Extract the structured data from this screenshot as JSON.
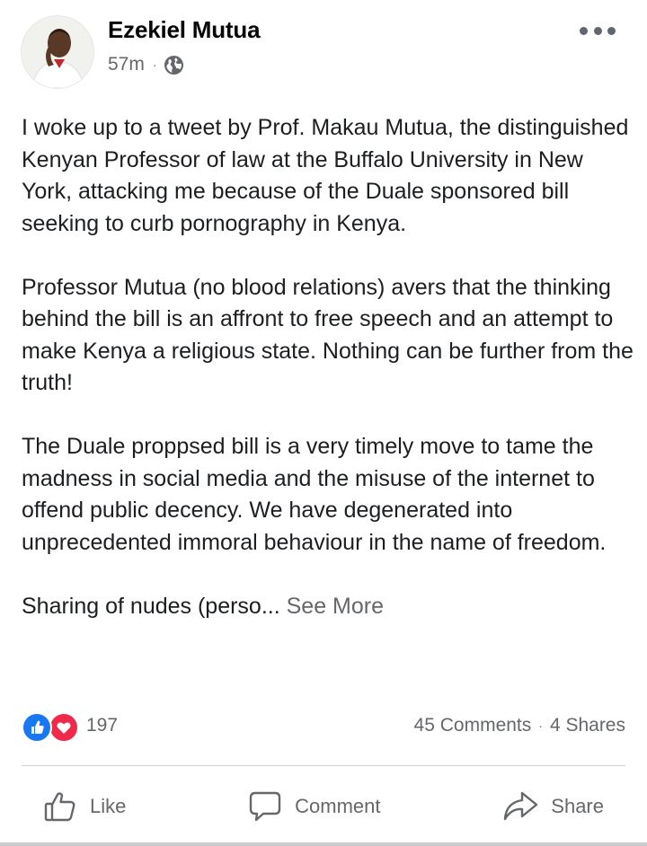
{
  "header": {
    "author_name": "Ezekiel Mutua",
    "timestamp": "57m",
    "separator": "·",
    "privacy_icon": "globe-icon",
    "more_icon": "more-options-icon"
  },
  "post": {
    "paragraphs": [
      "I woke up to a tweet by Prof. Makau Mutua, the distinguished Kenyan Professor of law at the Buffalo University in New York, attacking me because of the Duale sponsored bill seeking to curb pornography in Kenya.",
      "Professor Mutua (no blood relations) avers that the thinking behind the bill is an affront to free speech and an attempt to make Kenya a religious state. Nothing can be further from the truth!",
      "The Duale proppsed bill is a very timely move to tame the madness in social media and the misuse of the internet to offend public decency. We have degenerated into unprecedented immoral behaviour in the name of freedom."
    ],
    "truncated_text": "Sharing of nudes (perso...",
    "see_more": "See More"
  },
  "stats": {
    "reaction_icons": [
      "like-reaction-icon",
      "love-reaction-icon"
    ],
    "reaction_count": "197",
    "comments": "45 Comments",
    "separator": "·",
    "shares": "4 Shares"
  },
  "actions": {
    "like_label": "Like",
    "comment_label": "Comment",
    "share_label": "Share"
  },
  "colors": {
    "like_blue": "#1877f2",
    "love_red": "#f02849",
    "secondary_text": "#65676b",
    "primary_text": "#050505"
  }
}
